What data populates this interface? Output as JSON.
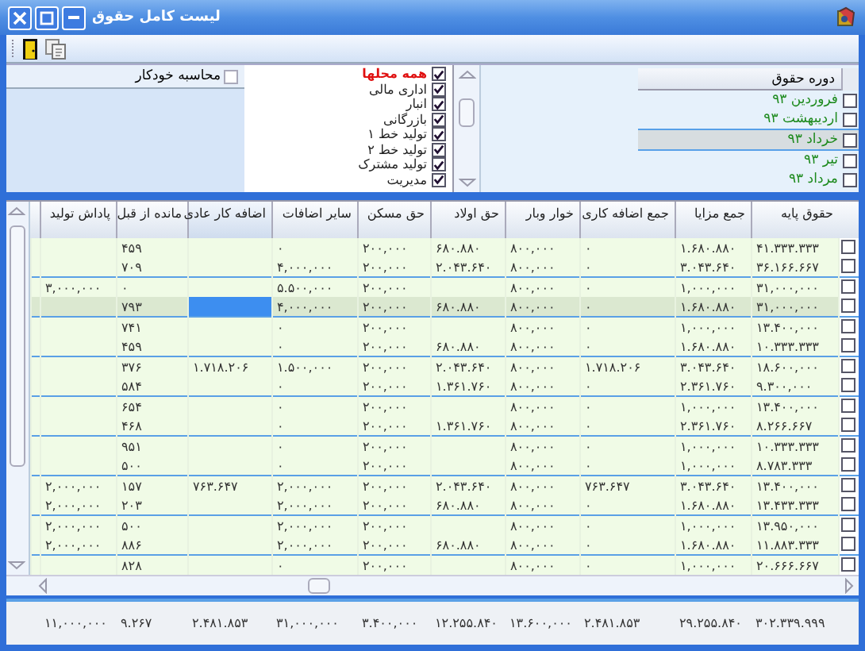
{
  "window": {
    "title": "لیست کامل حقوق"
  },
  "auto_calc": {
    "label": "محاسبه خودکار",
    "checked": false
  },
  "locations": [
    {
      "label": "همه محلها",
      "checked": true,
      "kind": "all"
    },
    {
      "label": "اداری مالی",
      "checked": true,
      "kind": "item"
    },
    {
      "label": "انبار",
      "checked": true,
      "kind": "item"
    },
    {
      "label": "بازرگانی",
      "checked": true,
      "kind": "item"
    },
    {
      "label": "تولید خط ۱",
      "checked": true,
      "kind": "item"
    },
    {
      "label": "تولید خط ۲",
      "checked": true,
      "kind": "item"
    },
    {
      "label": "تولید مشترک",
      "checked": true,
      "kind": "item"
    },
    {
      "label": "مدیریت",
      "checked": true,
      "kind": "item"
    }
  ],
  "periods": {
    "heading": "دوره حقوق",
    "items": [
      {
        "label": "فروردین ۹۳",
        "checked": false,
        "selected": false
      },
      {
        "label": "اردیبهشت ۹۳",
        "checked": false,
        "selected": false
      },
      {
        "label": "خرداد ۹۳",
        "checked": false,
        "selected": true
      },
      {
        "label": "تیر ۹۳",
        "checked": false,
        "selected": false
      },
      {
        "label": "مرداد ۹۳",
        "checked": false,
        "selected": false
      }
    ]
  },
  "table": {
    "columns": [
      {
        "label": "حقوق پایه",
        "current": false
      },
      {
        "label": "جمع مزایا",
        "current": false
      },
      {
        "label": "جمع اضافه کاری",
        "current": false
      },
      {
        "label": "خوار وبار",
        "current": false
      },
      {
        "label": "حق اولاد",
        "current": false
      },
      {
        "label": "حق مسکن",
        "current": false
      },
      {
        "label": "سایر اضافات",
        "current": false
      },
      {
        "label": "اضافه کار عادی",
        "current": true
      },
      {
        "label": "مانده از قبل",
        "current": false
      },
      {
        "label": "پاداش تولید",
        "current": false
      }
    ],
    "rows": [
      {
        "checked": false,
        "selected": false,
        "cells": [
          "۴۱.۳۳۳.۳۳۳",
          "۱.۶۸۰.۸۸۰",
          "۰",
          "۸۰۰,۰۰۰",
          "۶۸۰.۸۸۰",
          "۲۰۰,۰۰۰",
          "۰",
          null,
          "۴۵۹",
          null
        ]
      },
      {
        "checked": false,
        "selected": false,
        "cells": [
          "۳۶.۱۶۶.۶۶۷",
          "۳.۰۴۳.۶۴۰",
          "۰",
          "۸۰۰,۰۰۰",
          "۲.۰۴۳.۶۴۰",
          "۲۰۰,۰۰۰",
          "۴,۰۰۰,۰۰۰",
          null,
          "۷۰۹",
          null
        ]
      },
      {
        "checked": false,
        "selected": false,
        "cells": [
          "۳۱,۰۰۰,۰۰۰",
          "۱,۰۰۰,۰۰۰",
          "۰",
          "۸۰۰,۰۰۰",
          null,
          "۲۰۰,۰۰۰",
          "۵.۵۰۰,۰۰۰",
          null,
          "۰",
          "۳,۰۰۰,۰۰۰"
        ]
      },
      {
        "checked": false,
        "selected": true,
        "cells": [
          "۳۱,۰۰۰,۰۰۰",
          "۱.۶۸۰.۸۸۰",
          "۰",
          "۸۰۰,۰۰۰",
          "۶۸۰.۸۸۰",
          "۲۰۰,۰۰۰",
          "۴,۰۰۰,۰۰۰",
          null,
          "۷۹۳",
          null
        ]
      },
      {
        "checked": false,
        "selected": false,
        "cells": [
          "۱۳.۴۰۰,۰۰۰",
          "۱,۰۰۰,۰۰۰",
          "۰",
          "۸۰۰,۰۰۰",
          null,
          "۲۰۰,۰۰۰",
          "۰",
          null,
          "۷۴۱",
          null
        ]
      },
      {
        "checked": false,
        "selected": false,
        "cells": [
          "۱۰.۳۳۳.۳۳۳",
          "۱.۶۸۰.۸۸۰",
          "۰",
          "۸۰۰,۰۰۰",
          "۶۸۰.۸۸۰",
          "۲۰۰,۰۰۰",
          "۰",
          null,
          "۴۵۹",
          null
        ]
      },
      {
        "checked": false,
        "selected": false,
        "cells": [
          "۱۸.۶۰۰,۰۰۰",
          "۳.۰۴۳.۶۴۰",
          "۱.۷۱۸.۲۰۶",
          "۸۰۰,۰۰۰",
          "۲.۰۴۳.۶۴۰",
          "۲۰۰,۰۰۰",
          "۱.۵۰۰,۰۰۰",
          "۱.۷۱۸.۲۰۶",
          "۳۷۶",
          null
        ]
      },
      {
        "checked": false,
        "selected": false,
        "cells": [
          "۹.۳۰۰,۰۰۰",
          "۲.۳۶۱.۷۶۰",
          "۰",
          "۸۰۰,۰۰۰",
          "۱.۳۶۱.۷۶۰",
          "۲۰۰,۰۰۰",
          "۰",
          null,
          "۵۸۴",
          null
        ]
      },
      {
        "checked": false,
        "selected": false,
        "cells": [
          "۱۳.۴۰۰,۰۰۰",
          "۱,۰۰۰,۰۰۰",
          "۰",
          "۸۰۰,۰۰۰",
          null,
          "۲۰۰,۰۰۰",
          "۰",
          null,
          "۶۵۴",
          null
        ]
      },
      {
        "checked": false,
        "selected": false,
        "cells": [
          "۸.۲۶۶.۶۶۷",
          "۲.۳۶۱.۷۶۰",
          "۰",
          "۸۰۰,۰۰۰",
          "۱.۳۶۱.۷۶۰",
          "۲۰۰,۰۰۰",
          "۰",
          null,
          "۴۶۸",
          null
        ]
      },
      {
        "checked": false,
        "selected": false,
        "cells": [
          "۱۰.۳۳۳.۳۳۳",
          "۱,۰۰۰,۰۰۰",
          "۰",
          "۸۰۰,۰۰۰",
          null,
          "۲۰۰,۰۰۰",
          "۰",
          null,
          "۹۵۱",
          null
        ]
      },
      {
        "checked": false,
        "selected": false,
        "cells": [
          "۸.۷۸۳.۳۳۳",
          "۱,۰۰۰,۰۰۰",
          "۰",
          "۸۰۰,۰۰۰",
          null,
          "۲۰۰,۰۰۰",
          "۰",
          null,
          "۵۰۰",
          null
        ]
      },
      {
        "checked": false,
        "selected": false,
        "cells": [
          "۱۳.۴۰۰,۰۰۰",
          "۳.۰۴۳.۶۴۰",
          "۷۶۳.۶۴۷",
          "۸۰۰,۰۰۰",
          "۲.۰۴۳.۶۴۰",
          "۲۰۰,۰۰۰",
          "۲,۰۰۰,۰۰۰",
          "۷۶۳.۶۴۷",
          "۱۵۷",
          "۲,۰۰۰,۰۰۰"
        ]
      },
      {
        "checked": false,
        "selected": false,
        "cells": [
          "۱۳.۴۳۳.۳۳۳",
          "۱.۶۸۰.۸۸۰",
          "۰",
          "۸۰۰,۰۰۰",
          "۶۸۰.۸۸۰",
          "۲۰۰,۰۰۰",
          "۲,۰۰۰,۰۰۰",
          null,
          "۲۰۳",
          "۲,۰۰۰,۰۰۰"
        ]
      },
      {
        "checked": false,
        "selected": false,
        "cells": [
          "۱۳.۹۵۰,۰۰۰",
          "۱,۰۰۰,۰۰۰",
          "۰",
          "۸۰۰,۰۰۰",
          null,
          "۲۰۰,۰۰۰",
          "۲,۰۰۰,۰۰۰",
          null,
          "۵۰۰",
          "۲,۰۰۰,۰۰۰"
        ]
      },
      {
        "checked": false,
        "selected": false,
        "cells": [
          "۱۱.۸۸۳.۳۳۳",
          "۱.۶۸۰.۸۸۰",
          "۰",
          "۸۰۰,۰۰۰",
          "۶۸۰.۸۸۰",
          "۲۰۰,۰۰۰",
          "۲,۰۰۰,۰۰۰",
          null,
          "۸۸۶",
          "۲,۰۰۰,۰۰۰"
        ]
      },
      {
        "checked": false,
        "selected": false,
        "cells": [
          "۲۰.۶۶۶.۶۶۷",
          "۱,۰۰۰,۰۰۰",
          "۰",
          "۸۰۰,۰۰۰",
          null,
          "۲۰۰,۰۰۰",
          "۰",
          null,
          "۸۲۸",
          null
        ]
      }
    ],
    "totals": [
      "۳۰۲.۳۳۹.۹۹۹",
      "۲۹.۲۵۵.۸۴۰",
      "۲.۴۸۱.۸۵۳",
      "۱۳.۶۰۰,۰۰۰",
      "۱۲.۲۵۵.۸۴۰",
      "۳.۴۰۰,۰۰۰",
      "۳۱,۰۰۰,۰۰۰",
      "۲.۴۸۱.۸۵۳",
      "۹.۲۶۷",
      "۱۱,۰۰۰,۰۰۰"
    ]
  }
}
